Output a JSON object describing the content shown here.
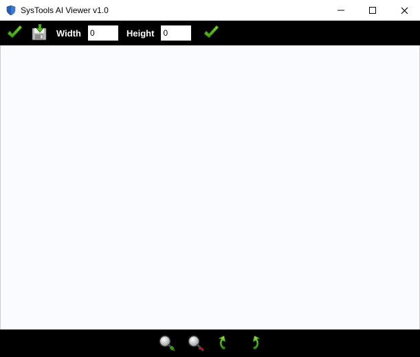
{
  "window": {
    "title": "SysTools AI Viewer v1.0"
  },
  "toolbar": {
    "width_label": "Width",
    "height_label": "Height",
    "width_value": "0",
    "height_value": "0"
  }
}
